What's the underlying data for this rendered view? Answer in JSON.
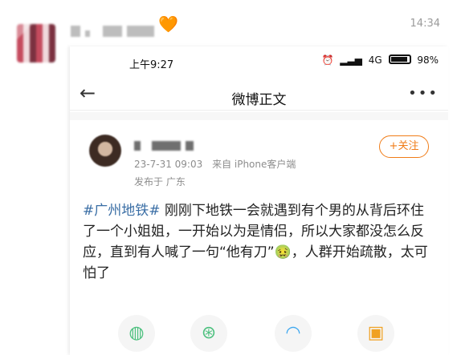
{
  "chat": {
    "time": "14:34",
    "emoji": "🧡"
  },
  "phone_status": {
    "time": "上午9:27",
    "network": "4G",
    "battery": "98%"
  },
  "weibo_nav": {
    "title": "微博正文",
    "back": "←",
    "more": "•••"
  },
  "post": {
    "date": "23-7-31 09:03",
    "source": "来自 iPhone客户端",
    "location": "发布于 广东",
    "follow_label": "+关注",
    "topic": "#广州地铁#",
    "content": " 刚刚下地铁一会就遇到有个男的从背后环住了一个小姐姐，一开始以为是情侣，所以大家都没怎么反应，直到有人喊了一句“他有刀”",
    "emoji_inline": "🤢",
    "content_tail": "，人群开始疏散，太可怕了"
  },
  "share": [
    {
      "icon": "wechat-icon",
      "glyph": "◍"
    },
    {
      "icon": "moments-icon",
      "glyph": "⊛"
    },
    {
      "icon": "qq-icon",
      "glyph": "◠"
    },
    {
      "icon": "save-image-icon",
      "glyph": "▣"
    }
  ]
}
